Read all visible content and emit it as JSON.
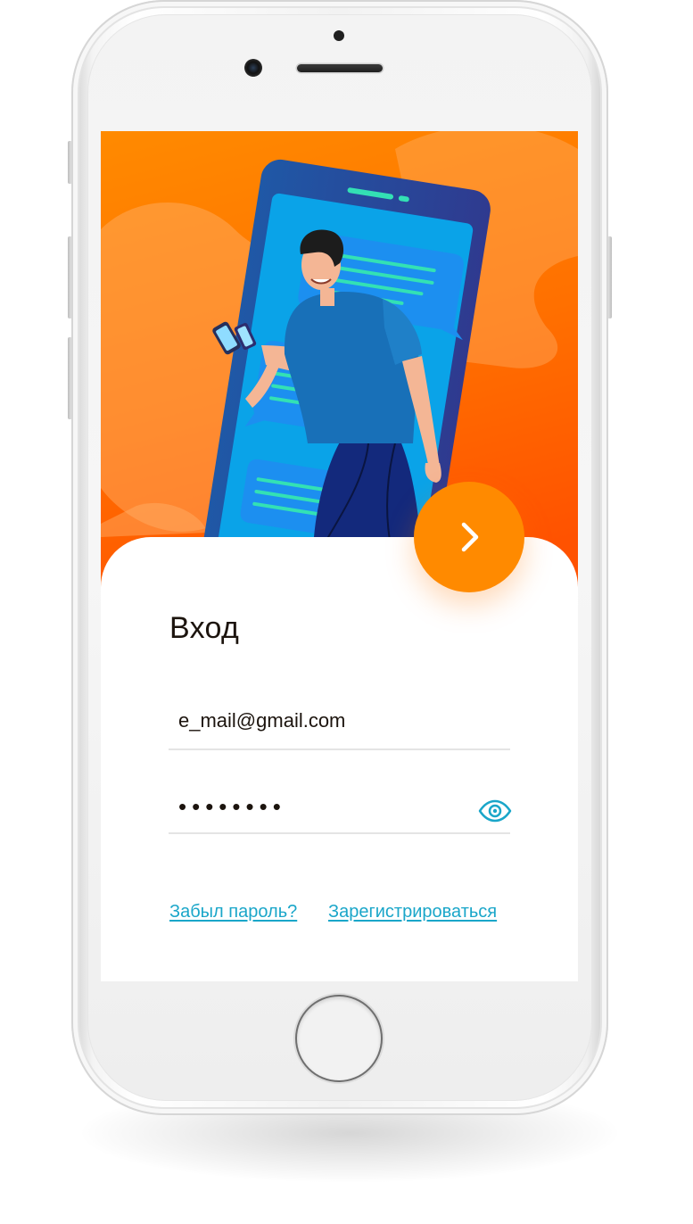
{
  "login": {
    "title": "Вход",
    "email_value": "e_mail@gmail.com",
    "password_value": "••••••••",
    "forgot_label": "Забыл пароль?",
    "register_label": "Зарегистрироваться"
  },
  "colors": {
    "accent": "#ff8a00",
    "link": "#1aa6c9",
    "hero_orange": "#ff7a00"
  },
  "icons": {
    "next": "chevron-right-icon",
    "password_toggle": "eye-icon"
  }
}
